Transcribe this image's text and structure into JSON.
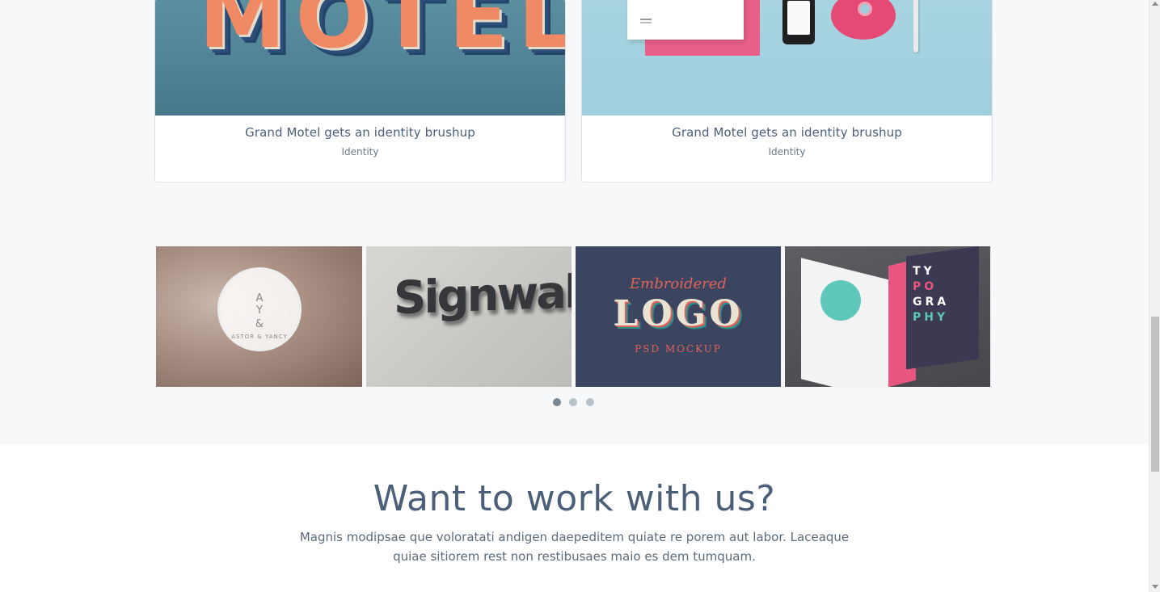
{
  "portfolio": {
    "cards": [
      {
        "title": "Grand Motel gets an identity brushup",
        "category": "Identity",
        "image_text": "MOTEL"
      },
      {
        "title": "Grand Motel gets an identity brushup",
        "category": "Identity"
      }
    ]
  },
  "gallery": {
    "tiles": [
      {
        "line1": "A Y",
        "line2": "&",
        "line3": "ASTOR & YANCY"
      },
      {
        "text": "Signwall"
      },
      {
        "line1": "Embroidered",
        "line2": "LOGO",
        "line3": "PSD MOCKUP"
      },
      {
        "circle_text": "",
        "word": [
          "TY",
          "PO",
          "GRA",
          "PHY"
        ]
      }
    ],
    "carousel": {
      "pages": 3,
      "active": 1
    }
  },
  "cta": {
    "heading": "Want to work with us?",
    "text": "Magnis modipsae que voloratati andigen daepeditem quiate re porem aut labor. Laceaque quiae sitiorem rest non restibusaes maio es dem tumquam."
  },
  "colors": {
    "text": "#4b6078",
    "page_bg": "#f7f8fa",
    "dot_active": "#7b8892",
    "dot_inactive": "#b7c1c8"
  }
}
